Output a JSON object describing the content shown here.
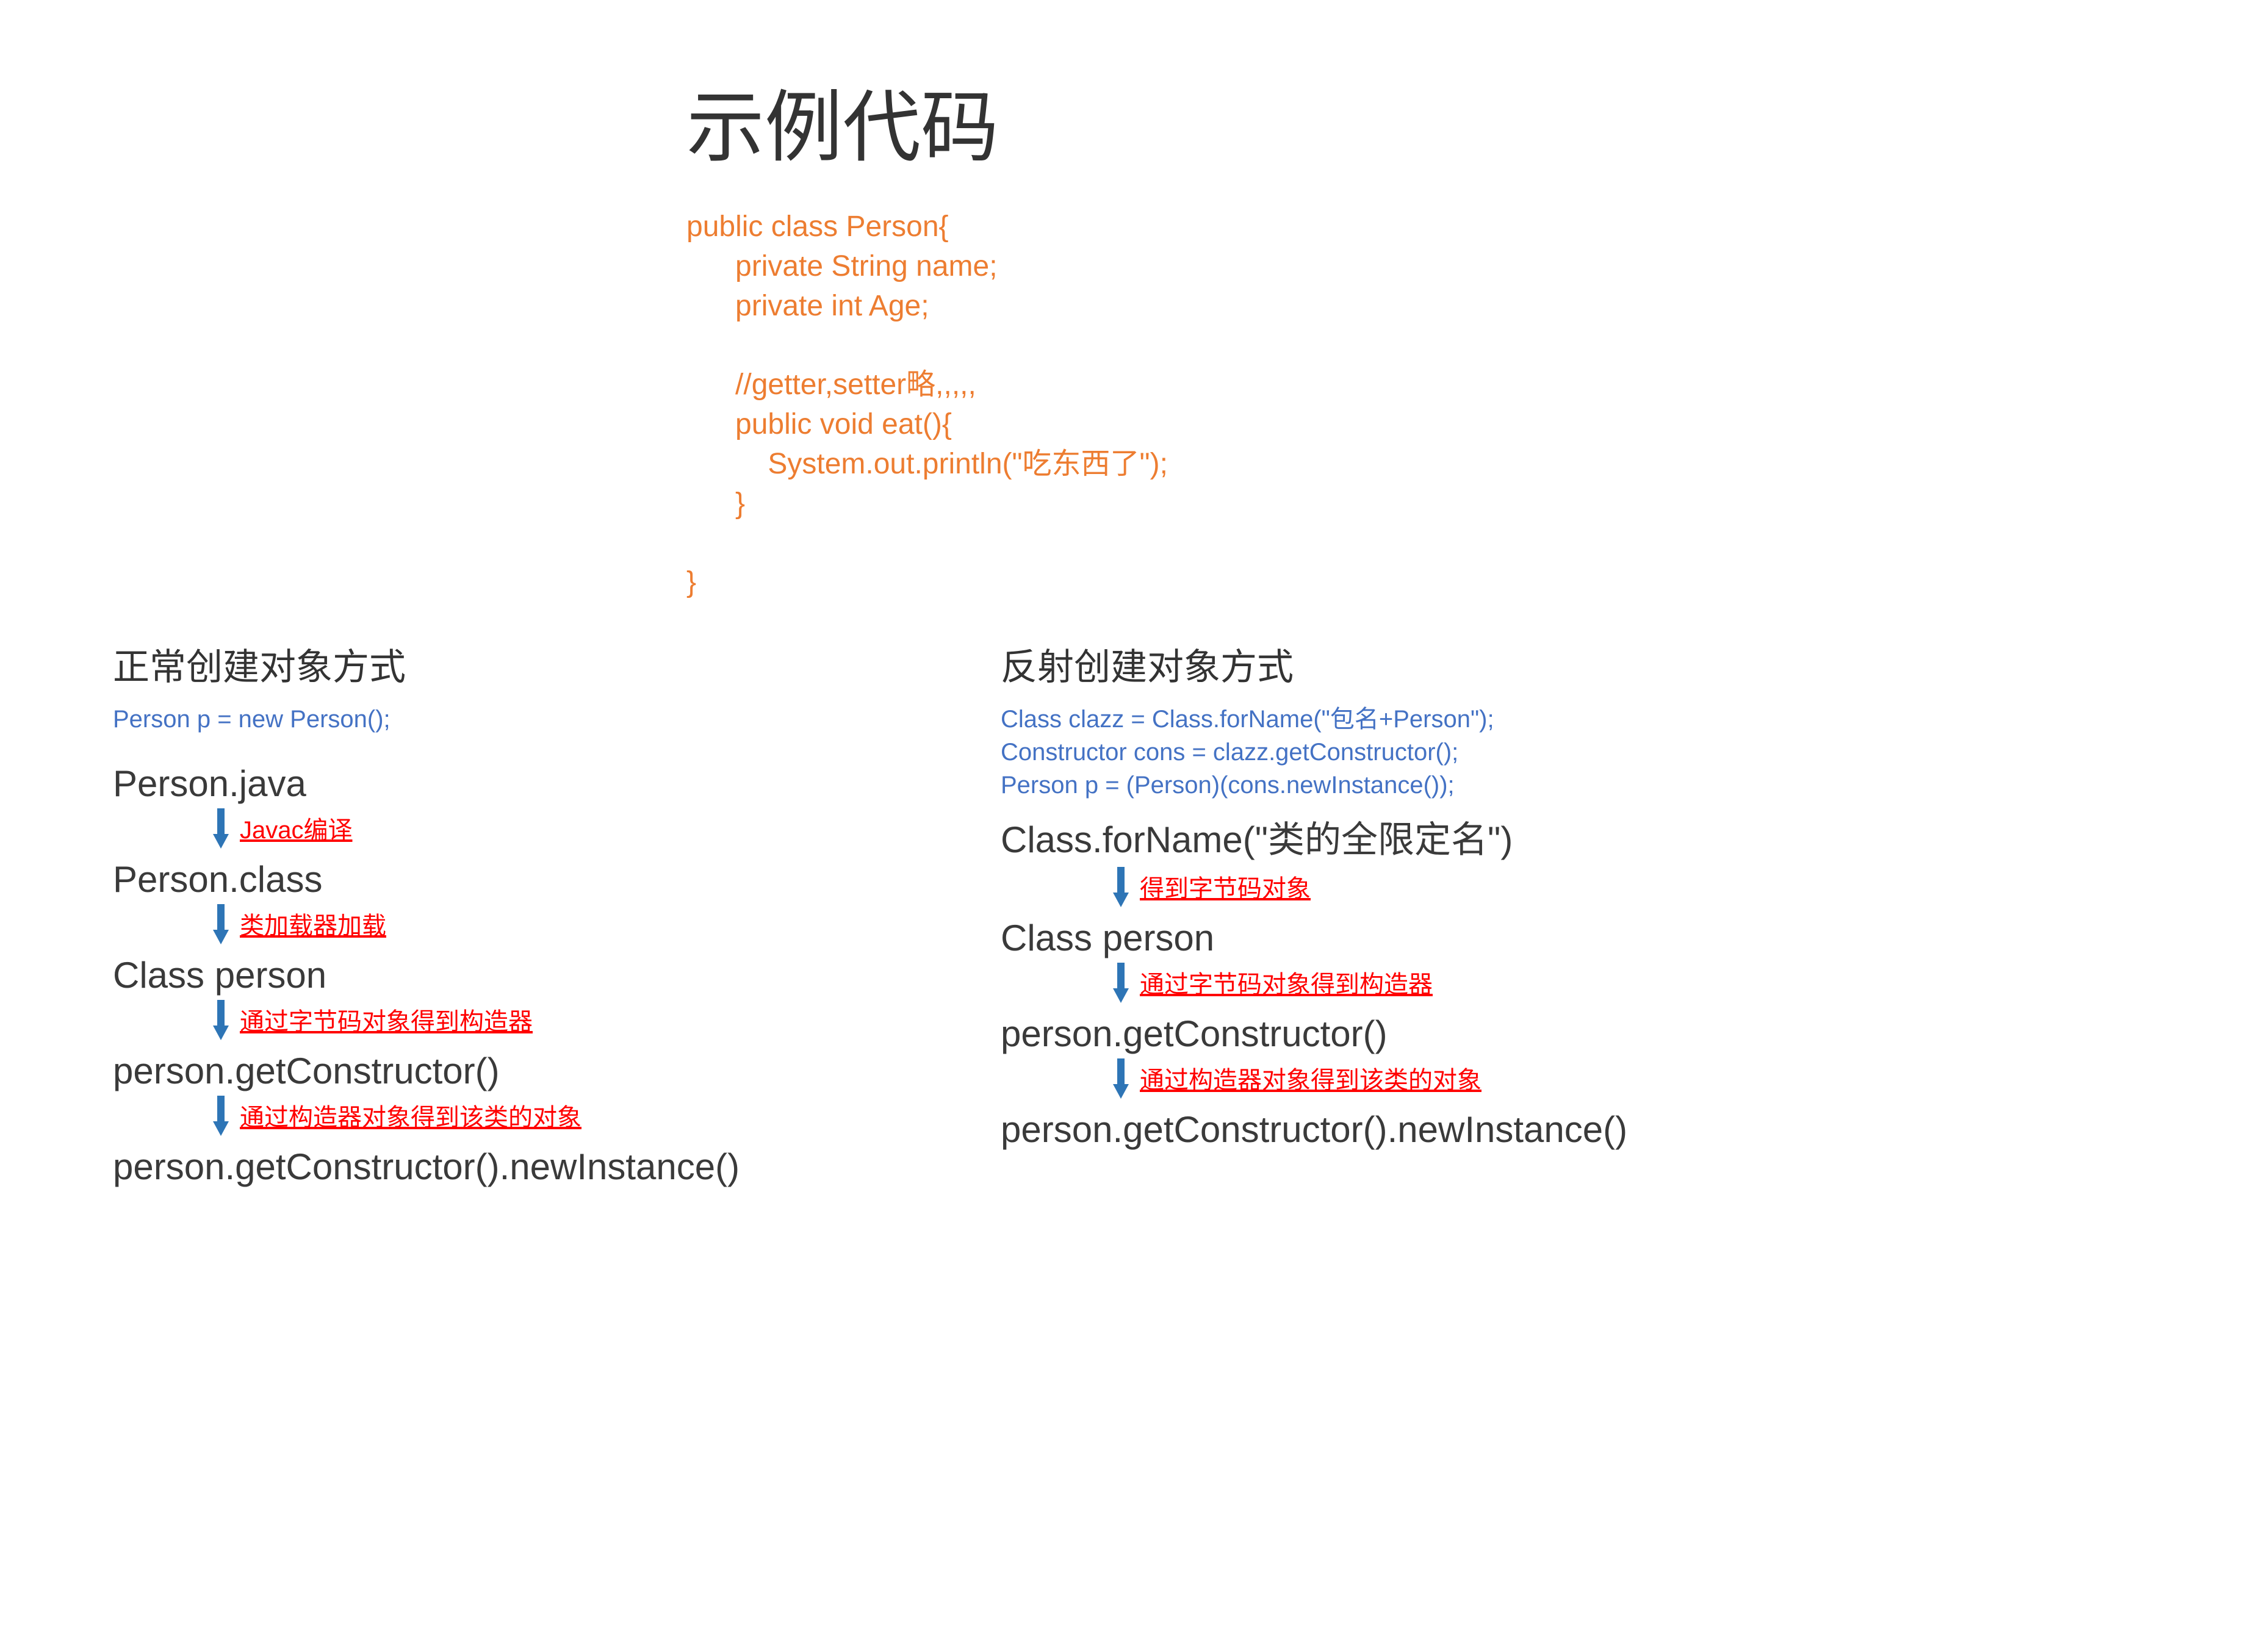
{
  "title": "示例代码",
  "code": {
    "l1": "public class Person{",
    "l2": "      private String name;",
    "l3": "      private int Age;",
    "l4": "",
    "l5": "      //getter,setter略,,,,,",
    "l6": "      public void eat(){",
    "l7": "          System.out.println(\"吃东西了\");",
    "l8": "      }",
    "l9": "",
    "l10": "}"
  },
  "left": {
    "heading": "正常创建对象方式",
    "code1": "Person p = new Person();",
    "step1": "Person.java",
    "arrow1": "Javac编译",
    "step2": "Person.class",
    "arrow2": "类加载器加载",
    "step3": "Class person",
    "arrow3": "通过字节码对象得到构造器",
    "step4": "person.getConstructor()",
    "arrow4": "通过构造器对象得到该类的对象",
    "step5": "person.getConstructor().newInstance()"
  },
  "right": {
    "heading": "反射创建对象方式",
    "code1": "Class clazz = Class.forName(\"包名+Person\");",
    "code2": "Constructor cons = clazz.getConstructor();",
    "code3": "Person p = (Person)(cons.newInstance());",
    "step1": "Class.forName(\"类的全限定名\")",
    "arrow1": "得到字节码对象",
    "step2": "Class person",
    "arrow2": "通过字节码对象得到构造器",
    "step3": "person.getConstructor()",
    "arrow3": "通过构造器对象得到该类的对象",
    "step4": "person.getConstructor().newInstance()"
  }
}
